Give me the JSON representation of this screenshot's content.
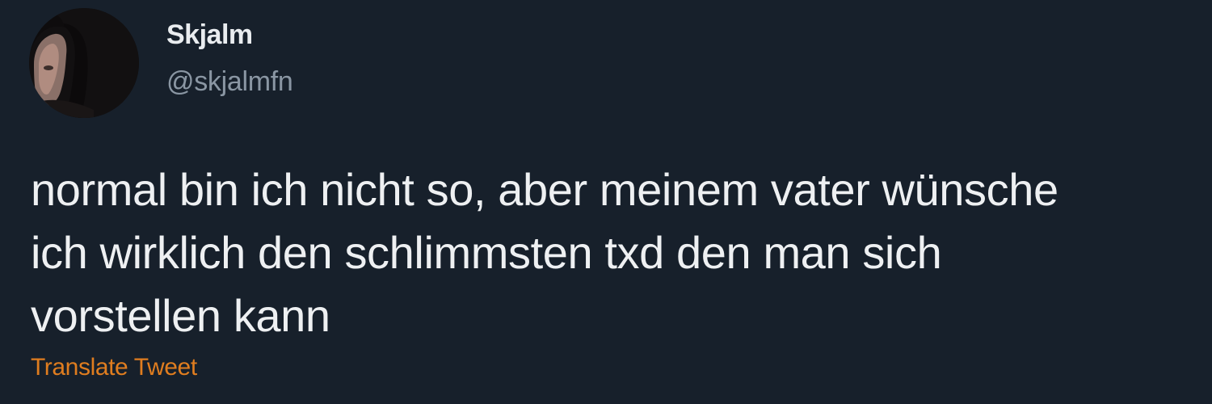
{
  "author": {
    "display_name": "Skjalm",
    "handle": "@skjalmfn",
    "avatar_icon": "profile-photo-avatar"
  },
  "tweet": {
    "text_lines": [
      "normal bin ich nicht so, aber meinem vater wünsche",
      "ich wirklich den schlimmsten txd den man sich",
      "vorstellen kann"
    ],
    "translate_label": "Translate Tweet"
  },
  "colors": {
    "background": "#17202b",
    "text": "#eef0f2",
    "handle": "#8a96a3",
    "translate_link": "#e07d1f"
  }
}
